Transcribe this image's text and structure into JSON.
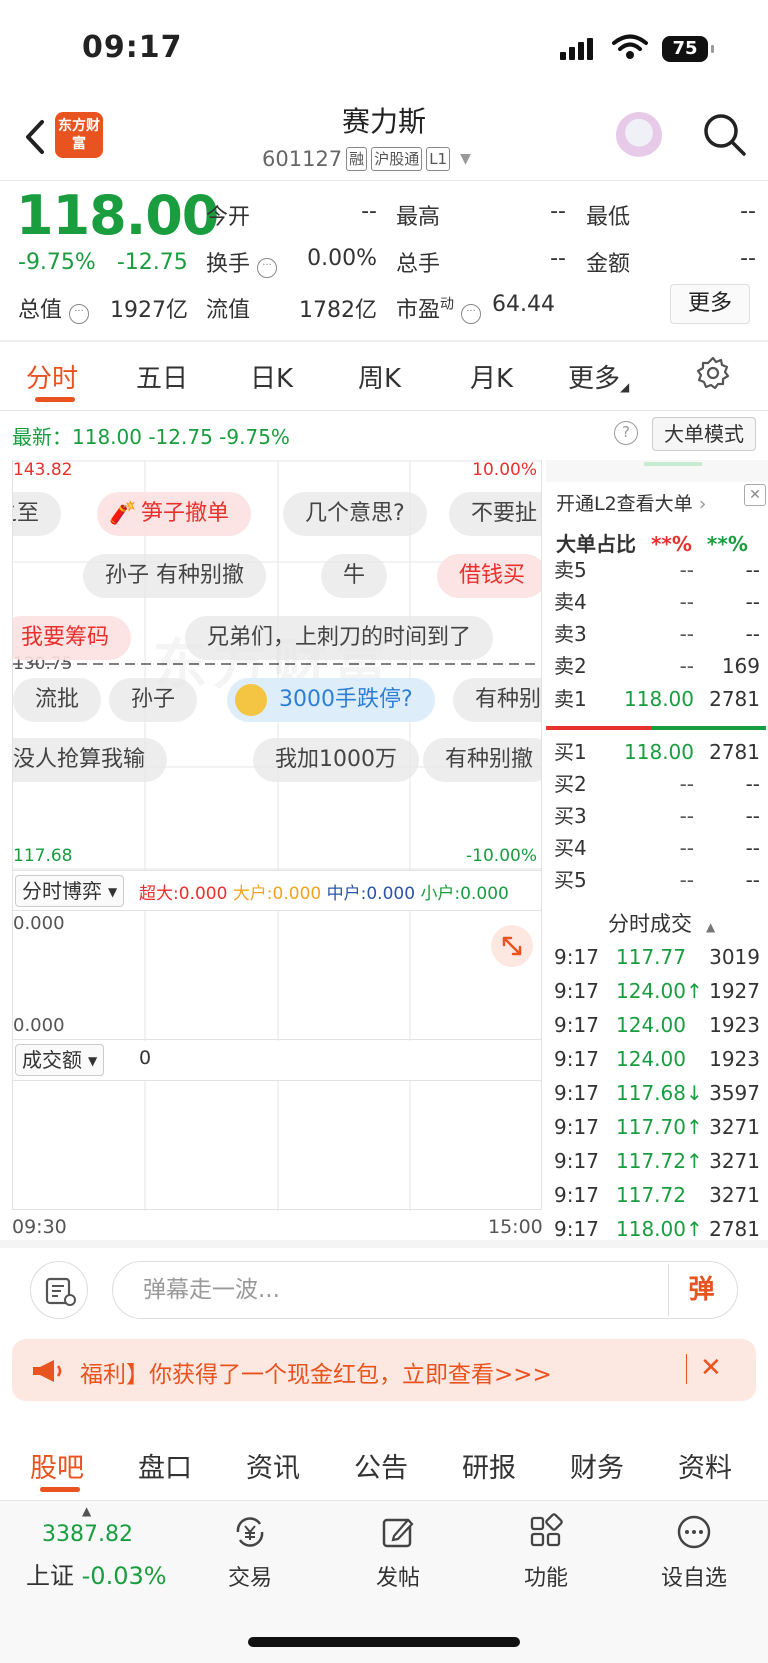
{
  "status": {
    "time": "09:17",
    "battery": "75"
  },
  "header": {
    "logo": "东方财富",
    "name": "赛力斯",
    "code": "601127",
    "tags": [
      "融",
      "沪股通",
      "L1"
    ]
  },
  "quote": {
    "price": "118.00",
    "pct": "-9.75%",
    "chg": "-12.75",
    "open_label": "今开",
    "open": "--",
    "high_label": "最高",
    "high": "--",
    "low_label": "最低",
    "low": "--",
    "turnover_label": "换手",
    "turnover": "0.00%",
    "vol_label": "总手",
    "vol": "--",
    "amount_label": "金额",
    "amount": "--",
    "mcap_label": "总值",
    "mcap": "1927亿",
    "float_label": "流值",
    "float": "1782亿",
    "pe_label": "市盈",
    "pe_sup": "动",
    "pe": "64.44",
    "more": "更多"
  },
  "tabs": [
    "分时",
    "五日",
    "日K",
    "周K",
    "月K",
    "更多"
  ],
  "latest": {
    "text": "最新：118.00  -12.75  -9.75%",
    "help": "?",
    "mode": "大单模式"
  },
  "chart": {
    "y_top": "143.82",
    "y_mid": "130.75",
    "y_bottom": "117.68",
    "pct_top": "10.00%",
    "pct_bottom": "-10.00%",
    "watermark": "东方财富",
    "danmu": [
      {
        "text": "之至"
      },
      {
        "text": "笋子撤单"
      },
      {
        "text": "几个意思?"
      },
      {
        "text": "不要扯"
      },
      {
        "text": "孙子 有种别撤"
      },
      {
        "text": "牛"
      },
      {
        "text": "借钱买"
      },
      {
        "text": "我要筹码"
      },
      {
        "text": "兄弟们，上刺刀的时间到了"
      },
      {
        "text": "流批"
      },
      {
        "text": "孙子"
      },
      {
        "text": "3000手跌停?"
      },
      {
        "text": "有种别"
      },
      {
        "text": "没人抢算我输"
      },
      {
        "text": "我加1000万"
      },
      {
        "text": "有种别撤"
      }
    ]
  },
  "game": {
    "dropdown": "分时博弈",
    "super_label": "超大:",
    "super": "0.000",
    "big_label": "大户:",
    "big": "0.000",
    "mid_label": "中户:",
    "mid": "0.000",
    "small_label": "小户:",
    "small": "0.000",
    "y_top": "0.000",
    "y_bottom": "0.000"
  },
  "volume": {
    "dropdown": "成交额",
    "value": "0",
    "t_start": "09:30",
    "t_end": "15:00"
  },
  "orderbook": {
    "l2_banner": "开通L2查看大单",
    "big_ratio_label": "大单占比",
    "big_ratio_red": "**%",
    "big_ratio_green": "**%",
    "asks": [
      {
        "label": "卖5",
        "price": "--",
        "vol": "--"
      },
      {
        "label": "卖4",
        "price": "--",
        "vol": "--"
      },
      {
        "label": "卖3",
        "price": "--",
        "vol": "--"
      },
      {
        "label": "卖2",
        "price": "--",
        "vol": "169"
      },
      {
        "label": "卖1",
        "price": "118.00",
        "vol": "2781"
      }
    ],
    "bids": [
      {
        "label": "买1",
        "price": "118.00",
        "vol": "2781"
      },
      {
        "label": "买2",
        "price": "--",
        "vol": "--"
      },
      {
        "label": "买3",
        "price": "--",
        "vol": "--"
      },
      {
        "label": "买4",
        "price": "--",
        "vol": "--"
      },
      {
        "label": "买5",
        "price": "--",
        "vol": "--"
      }
    ],
    "trades_title": "分时成交",
    "trades": [
      {
        "t": "9:17",
        "p": "117.77",
        "v": "3019"
      },
      {
        "t": "9:17",
        "p": "124.00↑",
        "v": "1927"
      },
      {
        "t": "9:17",
        "p": "124.00",
        "v": "1923"
      },
      {
        "t": "9:17",
        "p": "124.00",
        "v": "1923"
      },
      {
        "t": "9:17",
        "p": "117.68↓",
        "v": "3597"
      },
      {
        "t": "9:17",
        "p": "117.70↑",
        "v": "3271"
      },
      {
        "t": "9:17",
        "p": "117.72↑",
        "v": "3271"
      },
      {
        "t": "9:17",
        "p": "117.72",
        "v": "3271"
      },
      {
        "t": "9:17",
        "p": "118.00↑",
        "v": "2781"
      }
    ]
  },
  "comment": {
    "placeholder": "弹幕走一波...",
    "send": "弹"
  },
  "promo": {
    "text": "福利】你获得了一个现金红包，立即查看>>>",
    "close": "✕"
  },
  "bottom_tabs": [
    "股吧",
    "盘口",
    "资讯",
    "公告",
    "研报",
    "财务",
    "资料"
  ],
  "nav": {
    "index_value": "3387.82",
    "index_name": "上证",
    "index_pct": "-0.03%",
    "items": [
      "交易",
      "发帖",
      "功能",
      "设自选"
    ]
  }
}
